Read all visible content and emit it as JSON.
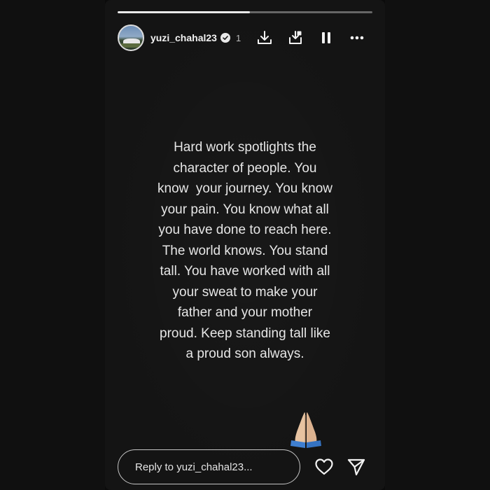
{
  "story": {
    "progress": 0.52,
    "username": "yuzi_chahal23",
    "verified": true,
    "time_ago": "1",
    "header_icons": [
      "download-icon",
      "save-to-device-icon",
      "pause-icon",
      "more-icon"
    ],
    "quote_lines": [
      "Hard work spotlights the",
      "character of people. You",
      "know  your journey. You know",
      "your pain. You know what all",
      "you have done to reach here.",
      "The world knows. You stand",
      "tall. You have worked with all",
      "your sweat to make your",
      "father and your mother",
      "proud. Keep standing tall like",
      "a proud son always."
    ],
    "sticker": "folded-hands-emoji"
  },
  "footer": {
    "reply_placeholder": "Reply to yuzi_chahal23...",
    "icons": [
      "heart-icon",
      "send-icon"
    ]
  },
  "colors": {
    "background": "#0b0b0b",
    "story_bg": "#141414",
    "text": "#e6e6e6"
  }
}
